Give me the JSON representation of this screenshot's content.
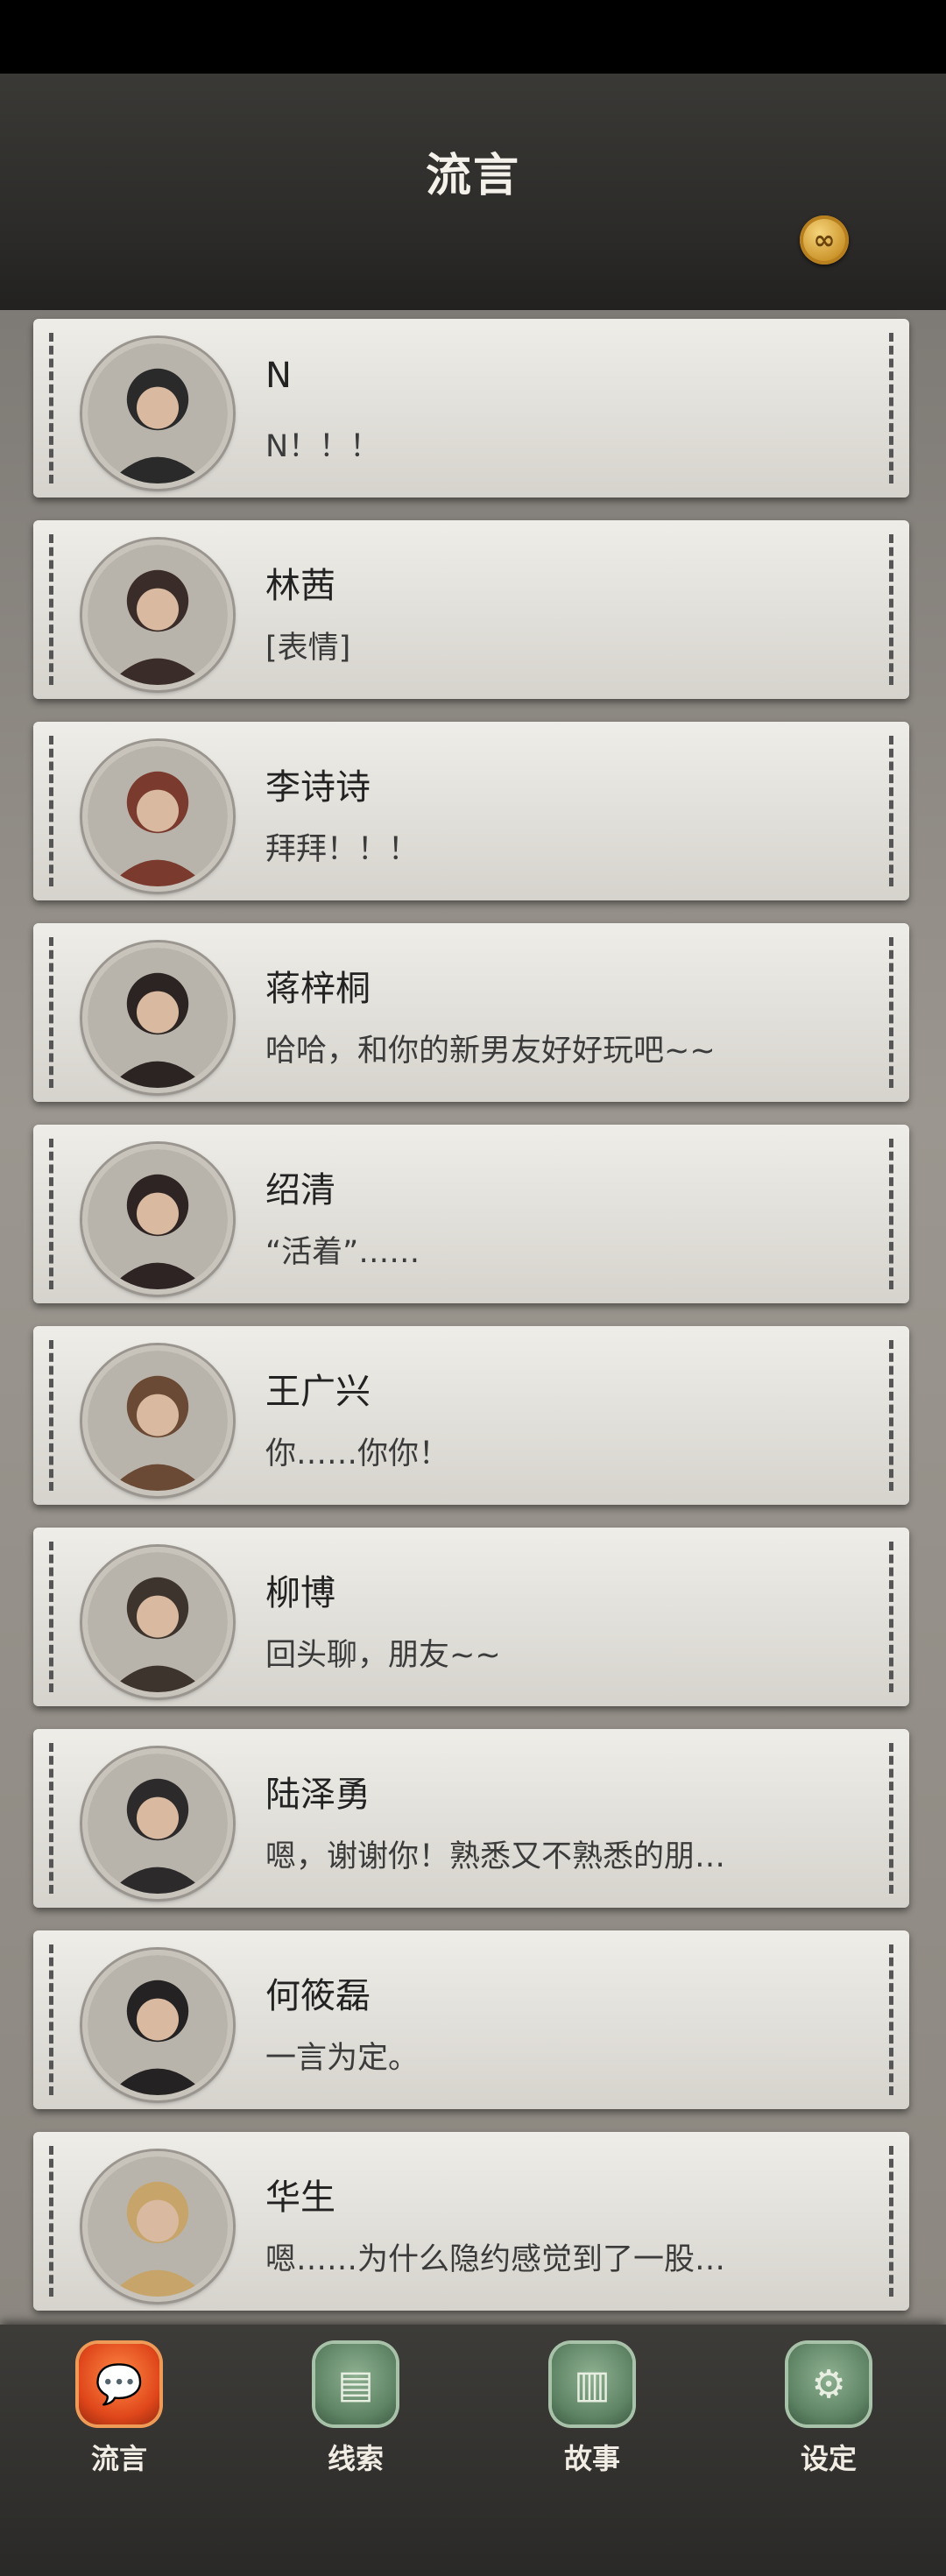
{
  "header": {
    "title": "流言",
    "coin_icon": "infinity-coin-icon"
  },
  "contacts": [
    {
      "name": "N",
      "message": "N！！！",
      "avatar": "#2a2a2a"
    },
    {
      "name": "林茜",
      "message": "[表情]",
      "avatar": "#3a2c28"
    },
    {
      "name": "李诗诗",
      "message": "拜拜！！！",
      "avatar": "#7a3a2e"
    },
    {
      "name": "蒋梓桐",
      "message": "哈哈，和你的新男友好好玩吧~~",
      "avatar": "#2b2422"
    },
    {
      "name": "绍清",
      "message": "“活着”……",
      "avatar": "#2e2424"
    },
    {
      "name": "王广兴",
      "message": "你……你你！",
      "avatar": "#6a4a34"
    },
    {
      "name": "柳博",
      "message": "回头聊，朋友~~",
      "avatar": "#3e342e"
    },
    {
      "name": "陆泽勇",
      "message": "嗯，谢谢你！熟悉又不熟悉的朋…",
      "avatar": "#2c2a2a"
    },
    {
      "name": "何筱磊",
      "message": "一言为定。",
      "avatar": "#242222"
    },
    {
      "name": "华生",
      "message": "嗯……为什么隐约感觉到了一股…",
      "avatar": "#c7a46a"
    }
  ],
  "tabs": [
    {
      "label": "流言",
      "icon": "chat-bubble-icon",
      "glyph": "💬",
      "active": true
    },
    {
      "label": "线索",
      "icon": "clue-notes-icon",
      "glyph": "▤",
      "active": false
    },
    {
      "label": "故事",
      "icon": "story-book-icon",
      "glyph": "▥",
      "active": false
    },
    {
      "label": "设定",
      "icon": "settings-gear-icon",
      "glyph": "⚙",
      "active": false
    }
  ]
}
